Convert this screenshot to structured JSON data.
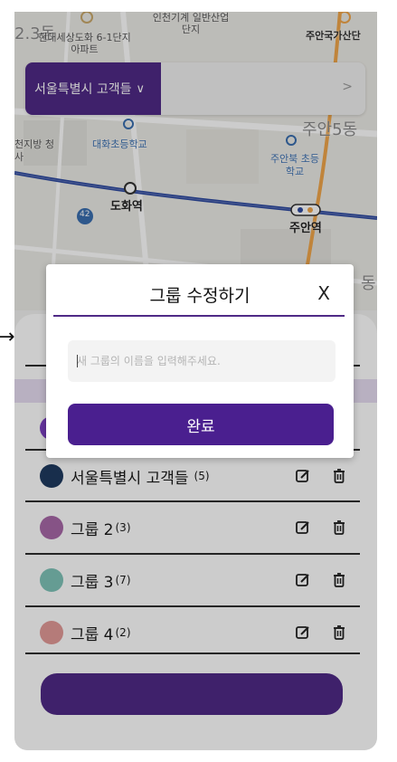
{
  "map": {
    "labels": {
      "area_left": "2.3동",
      "apartment": "현대세상도화 6-1단지아파트",
      "industrial": "인천기계 일반산업단지",
      "area_right": "주안국가산단",
      "dong_right": "주안5동",
      "office_left": "천지방 청사",
      "school_left": "대화초등학교",
      "school_right": "주안북 초등학교",
      "station_left": "도화역",
      "station_right": "주안역",
      "road_badge": "42",
      "edge_dong": "동"
    }
  },
  "selector": {
    "selected_group": "서울특별시 고객들",
    "chevron": "∨",
    "arrow": ">"
  },
  "groups": [
    {
      "name": "서울특별시 고객들",
      "count": "(5)",
      "color": "#1f3a5f"
    },
    {
      "name": "그룹 2",
      "count": "(3)",
      "color": "#a868a8"
    },
    {
      "name": "그룹 3",
      "count": "(7)",
      "color": "#7fc4b8"
    },
    {
      "name": "그룹 4",
      "count": "(2)",
      "color": "#e39a98"
    }
  ],
  "side_arrow": "→",
  "modal": {
    "title": "그룹 수정하기",
    "close": "X",
    "input_placeholder": "새 그룹의 이름을 입력해주세요.",
    "input_value": "",
    "submit_label": "완료"
  },
  "colors": {
    "brand_purple": "#4f2a86",
    "submit_purple": "#4a1f8f",
    "divider": "#2f2f2f"
  },
  "icons": {
    "edit": "edit-icon",
    "delete": "trash-icon"
  }
}
